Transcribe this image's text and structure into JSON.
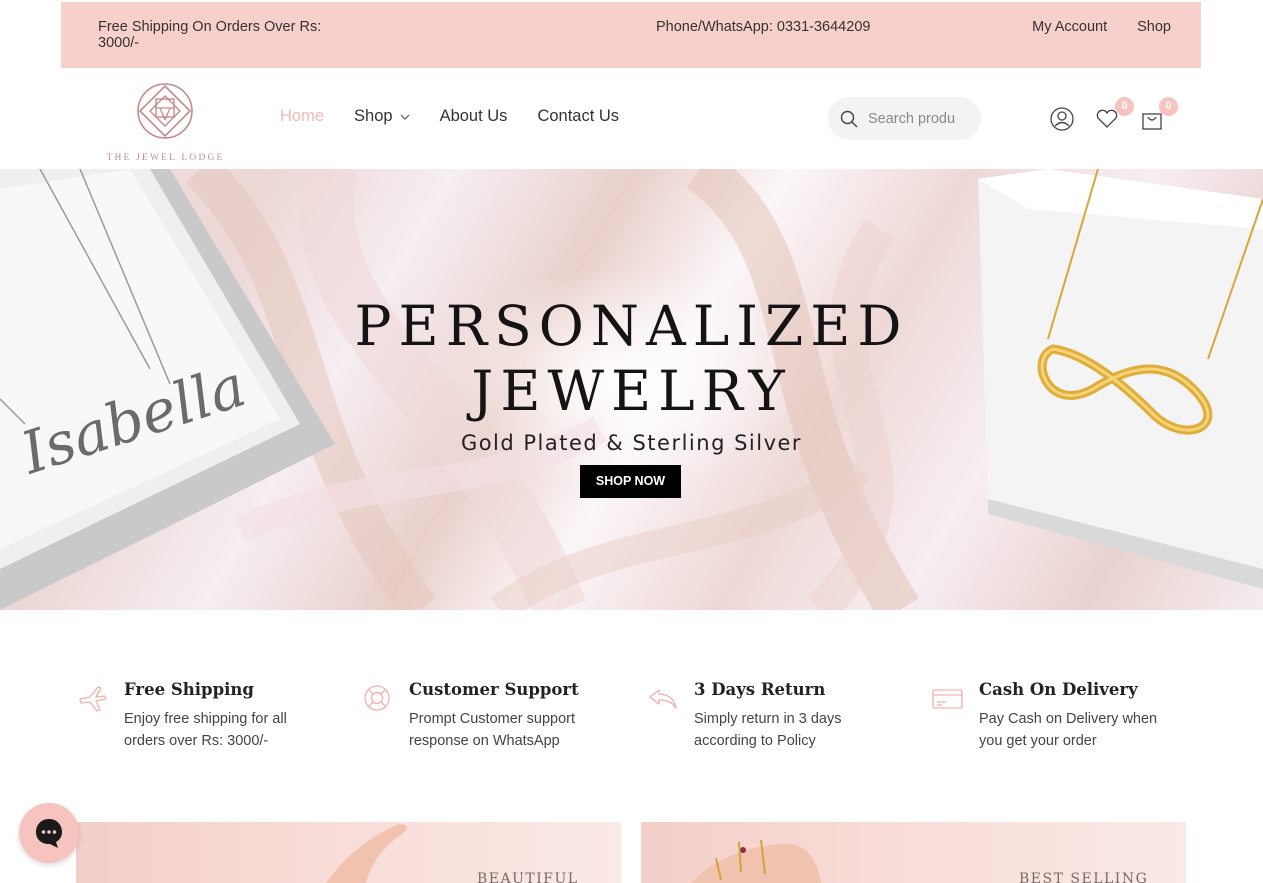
{
  "topbar": {
    "shipping_text": "Free Shipping On Orders Over Rs: 3000/-",
    "phone_text": "Phone/WhatsApp: 0331-3644209",
    "links": [
      "My Account",
      "Shop"
    ]
  },
  "header": {
    "logo_text": "THE JEWEL LODGE",
    "nav": [
      {
        "label": "Home",
        "active": true
      },
      {
        "label": "Shop",
        "dropdown": true
      },
      {
        "label": "About Us"
      },
      {
        "label": "Contact Us"
      }
    ],
    "search_placeholder": "Search products",
    "search_shown": "Search produ",
    "wishlist_count": "0",
    "cart_count": "0"
  },
  "hero": {
    "title_line1": "PERSONALIZED",
    "title_line2": "JEWELRY",
    "subtitle": "Gold Plated & Sterling Silver",
    "cta": "SHOP NOW",
    "left_necklace_text": "Isabella"
  },
  "features": [
    {
      "icon": "airplane-icon",
      "title": "Free Shipping",
      "desc": "Enjoy free shipping for all orders over Rs: 3000/-"
    },
    {
      "icon": "lifebuoy-icon",
      "title": "Customer Support",
      "desc": "Prompt Customer support response on WhatsApp"
    },
    {
      "icon": "return-arrow-icon",
      "title": "3 Days Return",
      "desc": "Simply return in 3 days according to Policy"
    },
    {
      "icon": "credit-card-icon",
      "title": "Cash On Delivery",
      "desc": "Pay Cash on Delivery when you get your order"
    }
  ],
  "banners": [
    {
      "text": "BEAUTIFUL"
    },
    {
      "text": "BEST SELLING"
    }
  ],
  "colors": {
    "accent_pink": "#f8d0cb",
    "active_nav": "#f3b9b5",
    "badge": "#f6c3be",
    "button_bg": "#000000"
  }
}
